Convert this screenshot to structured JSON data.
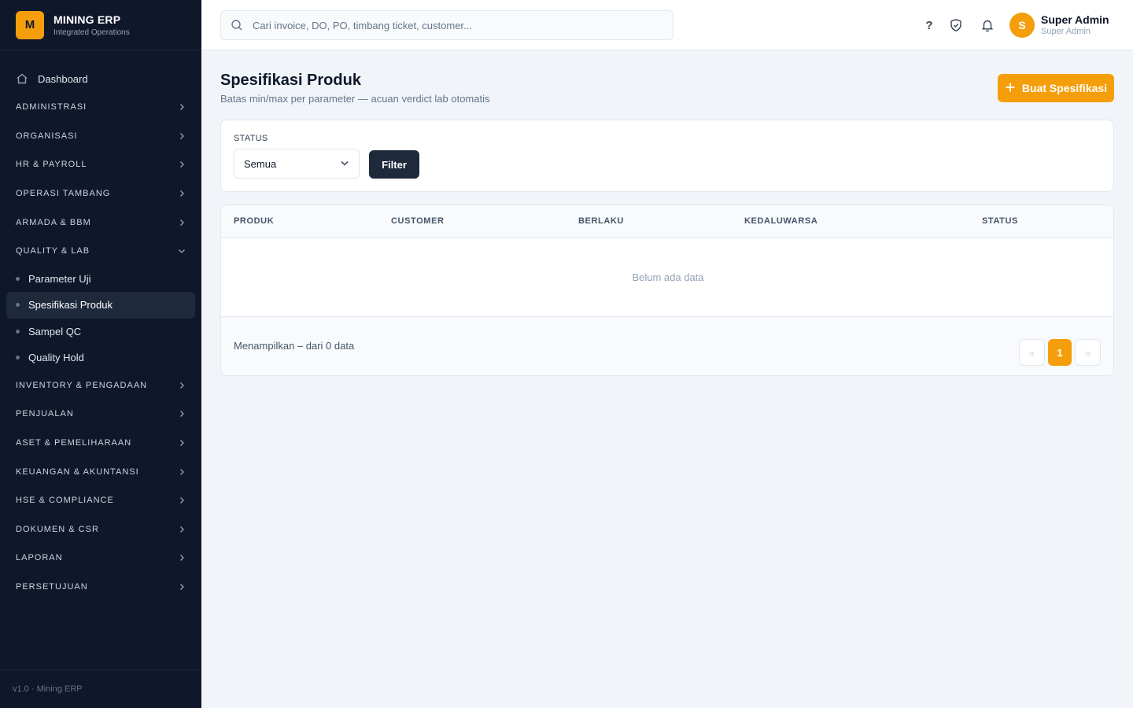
{
  "brand": {
    "logo_letter": "M",
    "title": "MINING ERP",
    "subtitle": "Integrated Operations"
  },
  "sidebar": {
    "dashboard": "Dashboard",
    "groups": [
      "ADMINISTRASI",
      "ORGANISASI",
      "HR & PAYROLL",
      "OPERASI TAMBANG",
      "ARMADA & BBM",
      "QUALITY & LAB"
    ],
    "quality_items": [
      "Parameter Uji",
      "Spesifikasi Produk",
      "Sampel QC",
      "Quality Hold"
    ],
    "active_item": "Spesifikasi Produk",
    "groups_after": [
      "INVENTORY & PENGADAAN",
      "PENJUALAN",
      "ASET & PEMELIHARAAN",
      "KEUANGAN & AKUNTANSI",
      "HSE & COMPLIANCE",
      "DOKUMEN & CSR",
      "LAPORAN",
      "PERSETUJUAN"
    ],
    "footer": "v1.0 · Mining ERP"
  },
  "topbar": {
    "search_placeholder": "Cari invoice, DO, PO, timbang ticket, customer...",
    "help_label": "?",
    "user": {
      "initial": "S",
      "name": "Super Admin",
      "role": "Super Admin"
    }
  },
  "page": {
    "title": "Spesifikasi Produk",
    "subtitle": "Batas min/max per parameter — acuan verdict lab otomatis",
    "create_button": "Buat Spesifikasi"
  },
  "filter": {
    "label": "STATUS",
    "selected": "Semua",
    "button": "Filter"
  },
  "table": {
    "columns": [
      "PRODUK",
      "CUSTOMER",
      "BERLAKU",
      "KEDALUWARSA",
      "STATUS"
    ],
    "empty_text": "Belum ada data",
    "footer_text": "Menampilkan – dari 0 data",
    "pagination": {
      "prev": "«",
      "current": "1",
      "next": "»"
    }
  },
  "colors": {
    "accent": "#f59e0b",
    "sidebar_bg": "#0f172a",
    "dark_button": "#1e293b"
  }
}
